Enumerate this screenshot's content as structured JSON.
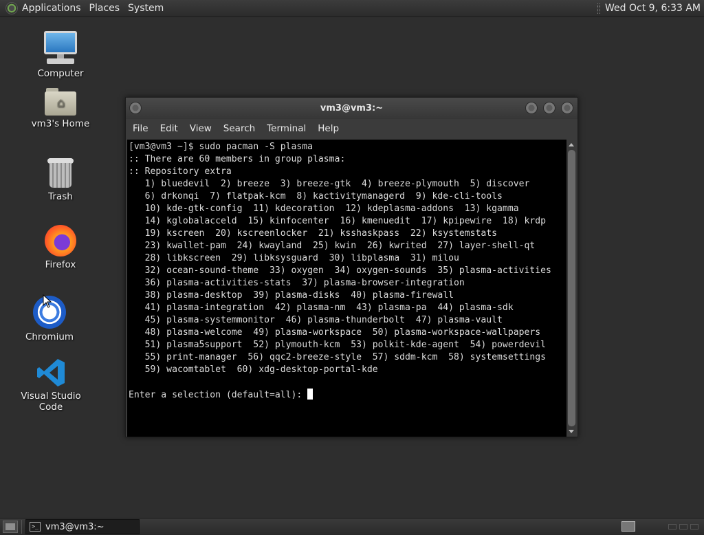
{
  "top_panel": {
    "menu": [
      "Applications",
      "Places",
      "System"
    ],
    "clock": "Wed Oct  9,  6:33 AM"
  },
  "desktop_icons": [
    {
      "label": "Computer"
    },
    {
      "label": "vm3's Home"
    },
    {
      "label": "Trash"
    },
    {
      "label": "Firefox"
    },
    {
      "label": "Chromium"
    },
    {
      "label": "Visual Studio Code"
    }
  ],
  "terminal": {
    "title": "vm3@vm3:~",
    "menu": [
      "File",
      "Edit",
      "View",
      "Search",
      "Terminal",
      "Help"
    ],
    "lines": [
      "[vm3@vm3 ~]$ sudo pacman -S plasma",
      ":: There are 60 members in group plasma:",
      ":: Repository extra",
      "   1) bluedevil  2) breeze  3) breeze-gtk  4) breeze-plymouth  5) discover",
      "   6) drkonqi  7) flatpak-kcm  8) kactivitymanagerd  9) kde-cli-tools",
      "   10) kde-gtk-config  11) kdecoration  12) kdeplasma-addons  13) kgamma",
      "   14) kglobalacceld  15) kinfocenter  16) kmenuedit  17) kpipewire  18) krdp",
      "   19) kscreen  20) kscreenlocker  21) ksshaskpass  22) ksystemstats",
      "   23) kwallet-pam  24) kwayland  25) kwin  26) kwrited  27) layer-shell-qt",
      "   28) libkscreen  29) libksysguard  30) libplasma  31) milou",
      "   32) ocean-sound-theme  33) oxygen  34) oxygen-sounds  35) plasma-activities",
      "   36) plasma-activities-stats  37) plasma-browser-integration",
      "   38) plasma-desktop  39) plasma-disks  40) plasma-firewall",
      "   41) plasma-integration  42) plasma-nm  43) plasma-pa  44) plasma-sdk",
      "   45) plasma-systemmonitor  46) plasma-thunderbolt  47) plasma-vault",
      "   48) plasma-welcome  49) plasma-workspace  50) plasma-workspace-wallpapers",
      "   51) plasma5support  52) plymouth-kcm  53) polkit-kde-agent  54) powerdevil",
      "   55) print-manager  56) qqc2-breeze-style  57) sddm-kcm  58) systemsettings",
      "   59) wacomtablet  60) xdg-desktop-portal-kde",
      "",
      "Enter a selection (default=all): "
    ]
  },
  "taskbar": {
    "task_label": "vm3@vm3:~",
    "task_icon_text": ">_"
  }
}
